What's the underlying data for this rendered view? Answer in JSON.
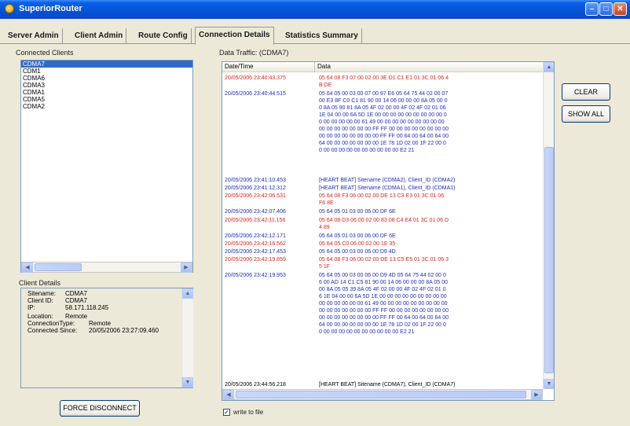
{
  "window": {
    "title": "SuperiorRouter"
  },
  "tabs": [
    {
      "label": "Server Admin"
    },
    {
      "label": "Client Admin"
    },
    {
      "label": "Route Config"
    },
    {
      "label": "Connection Details"
    },
    {
      "label": "Statistics Summary"
    }
  ],
  "clients": {
    "label": "Connected Clients",
    "items": [
      "CDMA7",
      "CDM1",
      "CDMA6",
      "CDMA3",
      "CDMA1",
      "CDMA5",
      "CDMA2"
    ]
  },
  "client_details": {
    "label": "Client Details",
    "rows": [
      {
        "key": "Sitename:",
        "value": "CDMA7"
      },
      {
        "key": "Client ID:",
        "value": "CDMA7"
      },
      {
        "key": "IP:",
        "value": "58.171.118.245"
      },
      {
        "key": "Location:",
        "value": "Remote"
      },
      {
        "key": "ConnectionType:",
        "value": "Remote"
      },
      {
        "key": "Connected Since:",
        "value": "20/05/2006   23:27:09.460"
      }
    ]
  },
  "buttons": {
    "force_disconnect": "FORCE DISCONNECT",
    "clear": "CLEAR",
    "show_all": "SHOW ALL"
  },
  "traffic": {
    "label": "Data Traffic: (CDMA7)",
    "col_datetime": "Date/Time",
    "col_data": "Data",
    "rows": [
      {
        "dt": "20/05/2006 23:40:43.375",
        "data": "05 64 08 F3 07 00 02 00 3E D1 C1 E1 01 3C 01 06 4B DE",
        "color": "red"
      },
      {
        "dt": "20/05/2006 23:40:44.515",
        "data": "05 64 05 00 03 00 07 00 97 E6 05 64 75 44 02 00 07 00 E3 8F C0 C1 81 90 00 14 06 00 00 00 8A 05 00 00 8A 05 90 81 8A 05 4F 02 00 00 4F 02 4F 02 01 06 1E 04 00 00 6A 5D 1E 00 00 00 00 00 00 00 00 00 00 00 00 00 00 00 61 49 00 00 00 00 00 00 00 00 00 00 00 00 00 00 00 00 FF FF 00 00 00 00 00 00 00 00 00 00 00 00 00 00 00 00 FF FF 00 64 00 64 00 64 00 64 00 00 00 00 00 00 00 1E 78 1D 02 00 1F 22 00 00 00 00 00 00 00 00 00 00 00 00 E2 21",
        "color": "blue"
      },
      {
        "dt": "20/05/2006 23:41:10.453",
        "data": "[HEART BEAT] Sitename (CDMA2), Client_ID (CDMA2)",
        "color": "blue"
      },
      {
        "dt": "20/05/2006 23:41:12.312",
        "data": "[HEART BEAT] Sitename (CDMA1), Client_ID (CDMA1)",
        "color": "blue"
      },
      {
        "dt": "20/05/2006 23:42:06.531",
        "data": "05 64 08 F3 06 00 02 00 DE 13 C3 E3 01 3C 01 06 F6 8E",
        "color": "red"
      },
      {
        "dt": "20/05/2006 23:42:07.406",
        "data": "05 64 05 01 03 00 06 00 DF 6E",
        "color": "blue"
      },
      {
        "dt": "20/05/2006 23:42:11.156",
        "data": "05 64 08 D3 06 00 02 00 83 08 C4 E4 01 3C 01 06 D4 89",
        "color": "red"
      },
      {
        "dt": "20/05/2006 23:42:12.171",
        "data": "05 64 05 01 03 00 06 00 DF 6E",
        "color": "blue"
      },
      {
        "dt": "20/05/2006 23:42:16.562",
        "data": "05 64 05 C0 06 00 02 00 1E 35",
        "color": "red"
      },
      {
        "dt": "20/05/2006 23:42:17.453",
        "data": "05 64 05 00 03 00 06 00 D9 4D",
        "color": "blue"
      },
      {
        "dt": "20/05/2006 23:42:19.859",
        "data": "05 64 08 F3 06 00 02 00 DE 13 C5 E5 01 3C 01 06 35 1F",
        "color": "red"
      },
      {
        "dt": "20/05/2006 23:42:19.953",
        "data": "05 64 05 00 03 00 06 00 D9 4D 05 64 75 44 02 00 06 00 AD 14 C1 C5 81 90 00 14 06 00 00 00 8A 05 00 00 8A 05 05 39 8A 05 4F 02 00 00 4F 02 4F 02 01 06 1E 04 00 00 6A 5D 1E 00 00 00 00 00 00 00 00 00 00 00 00 00 00 00 61 49 00 00 00 00 00 00 00 00 00 00 00 00 00 00 00 00 FF FF 00 00 00 00 00 00 00 00 00 00 00 00 00 00 00 00 FF FF 00 64 00 64 00 64 00 64 00 00 00 00 00 00 00 1E 78 1D 02 00 1F 22 00 00 00 00 00 00 00 00 00 00 00 00 E2 21",
        "color": "blue"
      },
      {
        "dt": "20/05/2006 23:44:56.218",
        "data": "[HEART BEAT] Sitename (CDMA7), Client_ID (CDMA7)",
        "color": "blue"
      }
    ]
  },
  "write_to_file": {
    "label": "write to file",
    "checked": true
  },
  "colors": {
    "red": "#E0231E",
    "blue": "#1C2EB8",
    "selection": "#316AC5"
  }
}
